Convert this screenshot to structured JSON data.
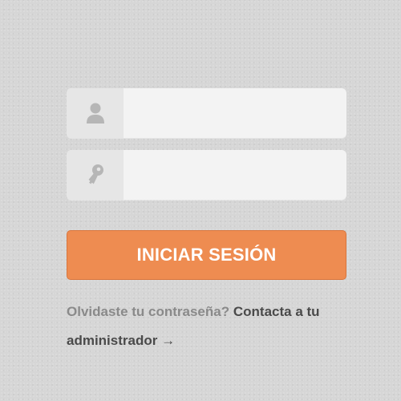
{
  "login": {
    "username": {
      "icon": "user-icon",
      "value": "",
      "placeholder": ""
    },
    "password": {
      "icon": "key-icon",
      "value": "",
      "placeholder": ""
    },
    "submit_label": "INICIAR SESIÓN",
    "help_question": "Olvidaste tu contraseña?",
    "help_link": "Contacta a tu administrador →"
  },
  "colors": {
    "background": "#d6d6d6",
    "field_background": "#f3f3f3",
    "icon_box_background": "#e6e6e6",
    "button": "#ee8c51",
    "button_text": "#ffffff",
    "muted_text": "#8a8a8a",
    "dark_text": "#4a4a4a"
  }
}
